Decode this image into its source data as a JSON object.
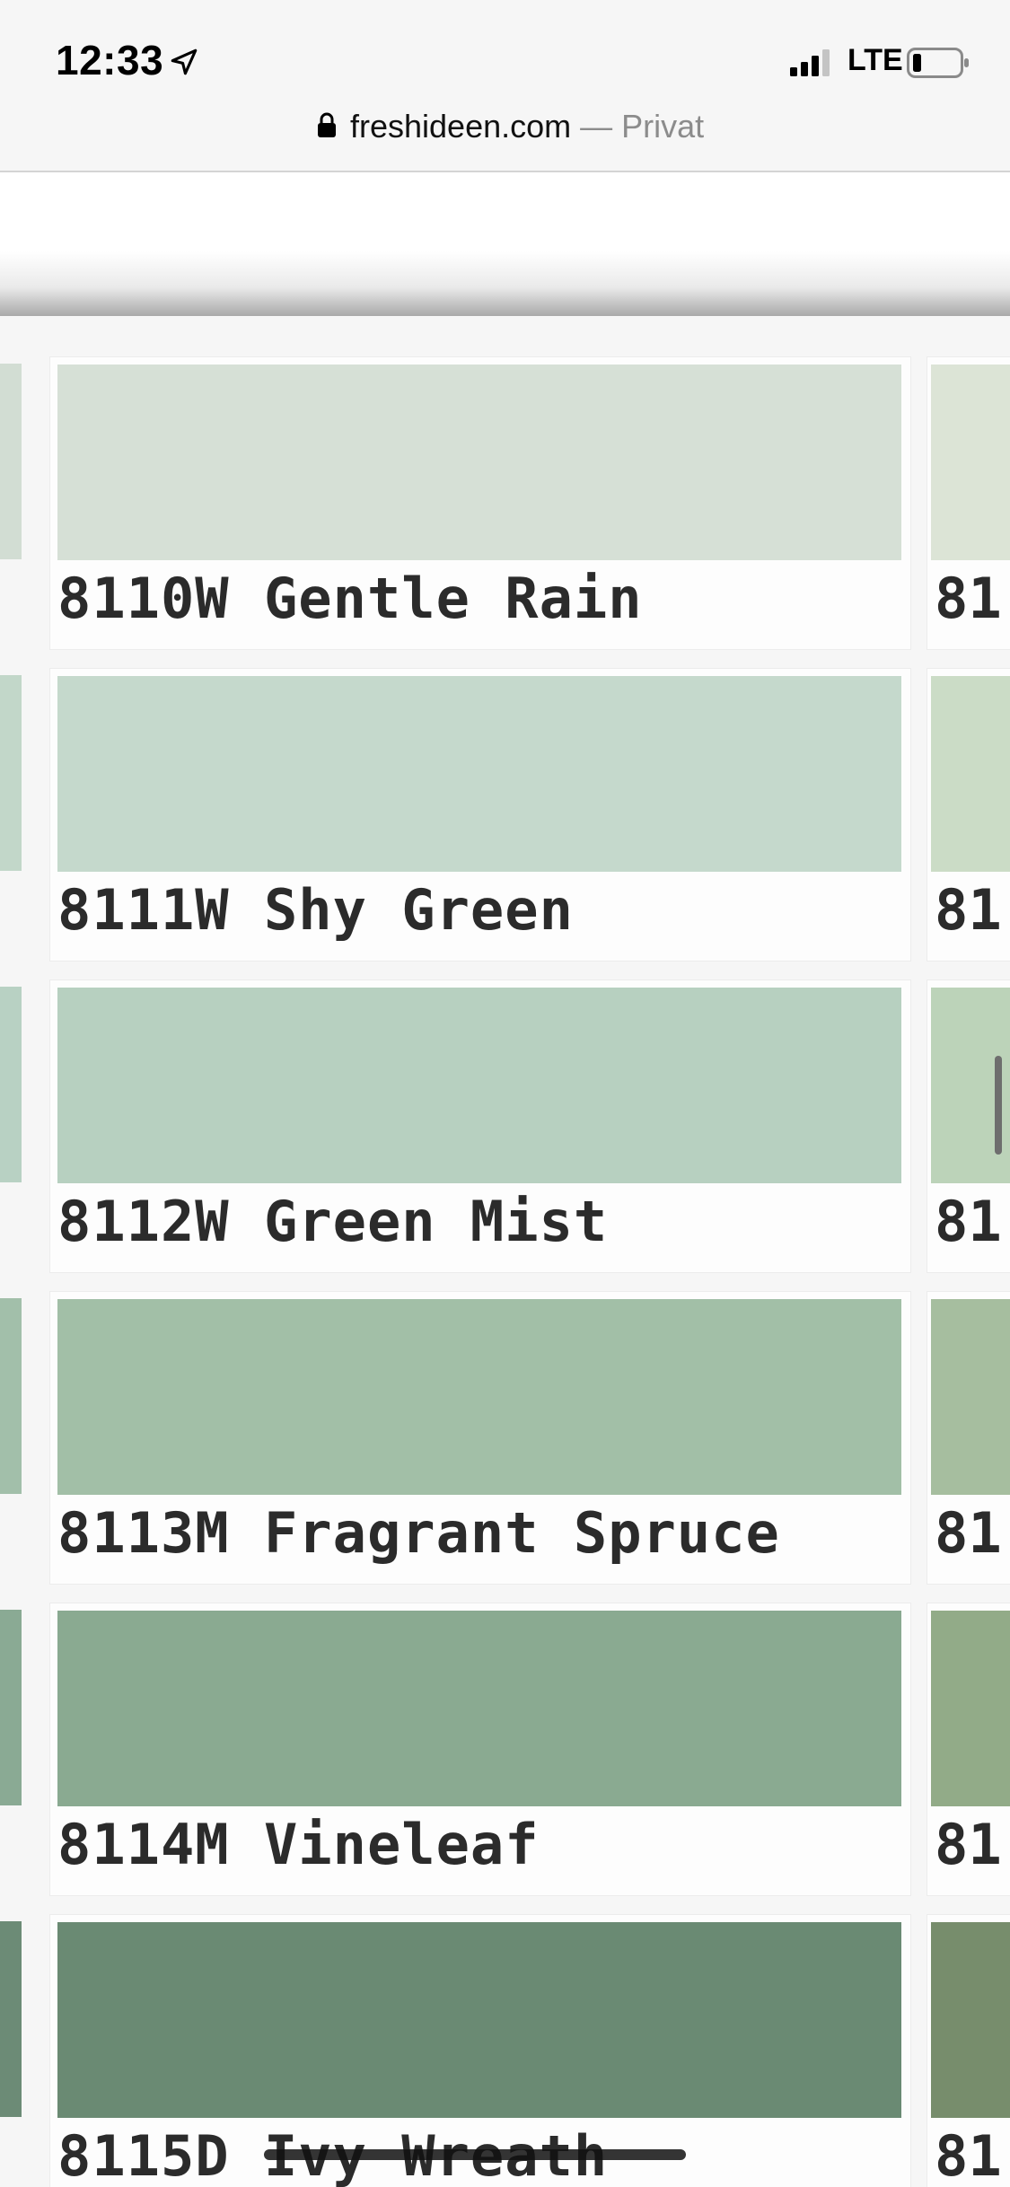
{
  "status_bar": {
    "time": "12:33",
    "network": "LTE",
    "location_icon": "location-arrow-icon",
    "signal_icon": "cellular-signal-icon",
    "battery_icon": "battery-low-icon"
  },
  "browser": {
    "url": "freshideen.com",
    "url_suffix": " — Privat",
    "lock_icon": "lock-icon"
  },
  "swatches": [
    {
      "label": "8110W Gentle Rain",
      "color": "#d6e0d6",
      "left_color": "#d2ddd3",
      "right_color": "#dce4d6",
      "right_label": "81"
    },
    {
      "label": "8111W Shy Green",
      "color": "#c5d9cc",
      "left_color": "#c2d7c9",
      "right_color": "#cbdcc6",
      "right_label": "81"
    },
    {
      "label": "8112W Green Mist",
      "color": "#b7d0c0",
      "left_color": "#b8d1c3",
      "right_color": "#bcd3b9",
      "right_label": "81"
    },
    {
      "label": "8113M Fragrant Spruce",
      "color": "#a2bfa7",
      "left_color": "#a2bfaa",
      "right_color": "#a6be9f",
      "right_label": "81"
    },
    {
      "label": "8114M Vineleaf",
      "color": "#8aaa91",
      "left_color": "#8aaa94",
      "right_color": "#92ab88",
      "right_label": "81"
    },
    {
      "label": "8115D Ivy Wreath",
      "color": "#6a8a73",
      "left_color": "#6c8b76",
      "right_color": "#778d6c",
      "right_label": "81"
    }
  ]
}
